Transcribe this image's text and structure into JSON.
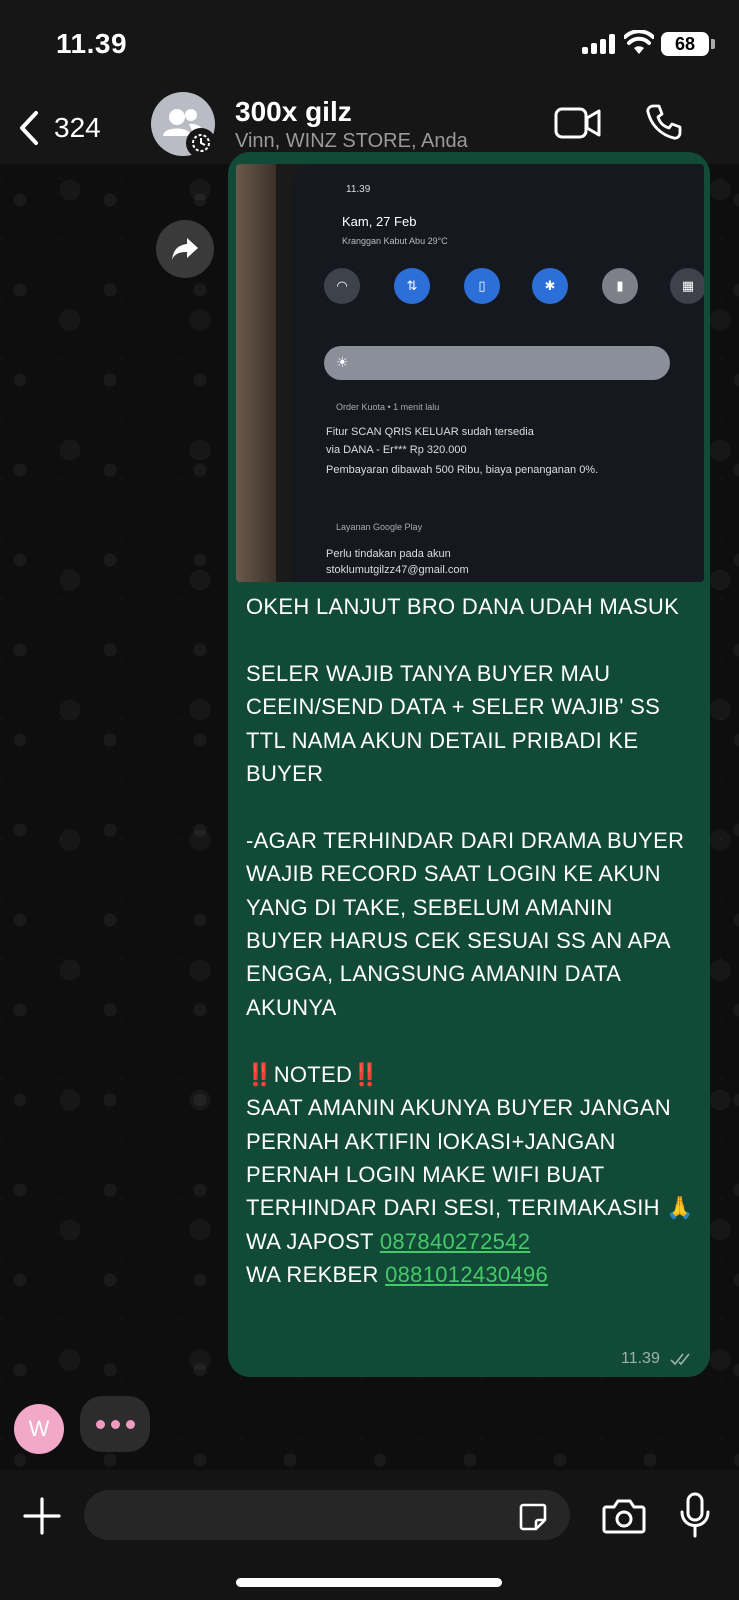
{
  "status_bar": {
    "time": "11.39",
    "battery": "68"
  },
  "header": {
    "back_count": "324",
    "title": "300x gilz",
    "subtitle": "Vinn, WINZ  STORE, Anda"
  },
  "photo": {
    "time": "11.39",
    "date": "Kam, 27 Feb",
    "location": "Kranggan Kabut Abu 29°C",
    "notif_app": "Order Kuota • 1 menit lalu",
    "notif_line1": "Fitur SCAN QRIS KELUAR sudah tersedia",
    "notif_line2": "via DANA - Er*** Rp 320.000",
    "notif_line3": "Pembayaran dibawah 500 Ribu, biaya penanganan 0%.",
    "notif2_app": "Layanan Google Play",
    "notif2_line1": "Perlu tindakan pada akun",
    "notif2_line2": "stoklumutgilzz47@gmail.com"
  },
  "message": {
    "body": "OKEH LANJUT BRO DANA UDAH MASUK\n\nSELER WAJIB TANYA BUYER MAU CEEIN/SEND DATA + SELER WAJIB' SS TTL NAMA AKUN DETAIL PRIBADI KE BUYER\n\n-AGAR TERHINDAR DARI DRAMA BUYER WAJIB RECORD SAAT LOGIN KE AKUN YANG DI TAKE, SEBELUM AMANIN BUYER HARUS CEK SESUAI SS AN APA ENGGA, LANGSUNG AMANIN DATA AKUNYA\n\n‼️NOTED‼️\nSAAT AMANIN AKUNYA BUYER JANGAN PERNAH AKTIFIN lOKASI+JANGAN PERNAH LOGIN MAKE WIFI BUAT TERHINDAR DARI SESI, TERIMAKASIH 🙏",
    "japost_label": "WA JAPOST ",
    "japost_number": "087840272542",
    "rekber_label": "WA REKBER ",
    "rekber_number": "0881012430496",
    "time": "11.39"
  },
  "typing": {
    "avatar_letter": "W"
  },
  "composer": {
    "placeholder": ""
  },
  "colors": {
    "bubble": "#114a36",
    "link": "#46c969",
    "typing_dots": "#f09bbd",
    "avatar": "#f2a8c8"
  }
}
